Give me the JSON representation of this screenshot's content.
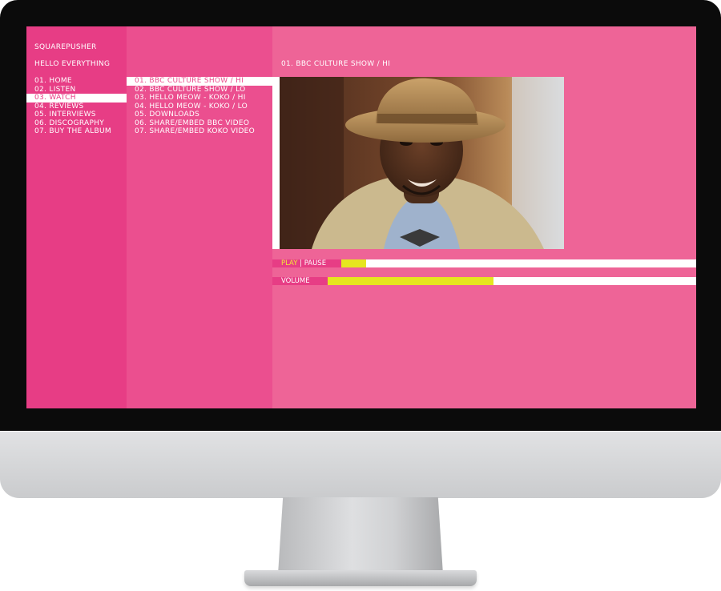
{
  "site": {
    "brand": "SQUAREPUSHER",
    "tagline": "HELLO EVERYTHING"
  },
  "nav": {
    "items": [
      {
        "label": "01. HOME",
        "active": false
      },
      {
        "label": "02. LISTEN",
        "active": false
      },
      {
        "label": "03. WATCH",
        "active": true
      },
      {
        "label": "04. REVIEWS",
        "active": false
      },
      {
        "label": "05. INTERVIEWS",
        "active": false
      },
      {
        "label": "06. DISCOGRAPHY",
        "active": false
      },
      {
        "label": "07. BUY THE ALBUM",
        "active": false
      }
    ]
  },
  "watch": {
    "items": [
      {
        "label": "01. BBC CULTURE SHOW / HI",
        "active": true
      },
      {
        "label": "02. BBC CULTURE SHOW / LO",
        "active": false
      },
      {
        "label": "03. HELLO MEOW - KOKO / HI",
        "active": false
      },
      {
        "label": "04. HELLO MEOW - KOKO / LO",
        "active": false
      },
      {
        "label": "05. DOWNLOADS",
        "active": false
      },
      {
        "label": "06. SHARE/EMBED BBC VIDEO",
        "active": false
      },
      {
        "label": "07. SHARE/EMBED KOKO VIDEO",
        "active": false
      }
    ]
  },
  "player": {
    "title": "01. BBC CULTURE SHOW / HI",
    "play_label": "PLAY",
    "separator": " | ",
    "pause_label": "PAUSE",
    "progress_fraction": 0.07,
    "volume_label": "VOLUME",
    "volume_fraction": 0.45
  },
  "colors": {
    "nav_bg": "#e73d85",
    "submenu_bg": "#eb4f8f",
    "content_bg": "#ee6497",
    "accent_yellow": "#e6e61f"
  }
}
